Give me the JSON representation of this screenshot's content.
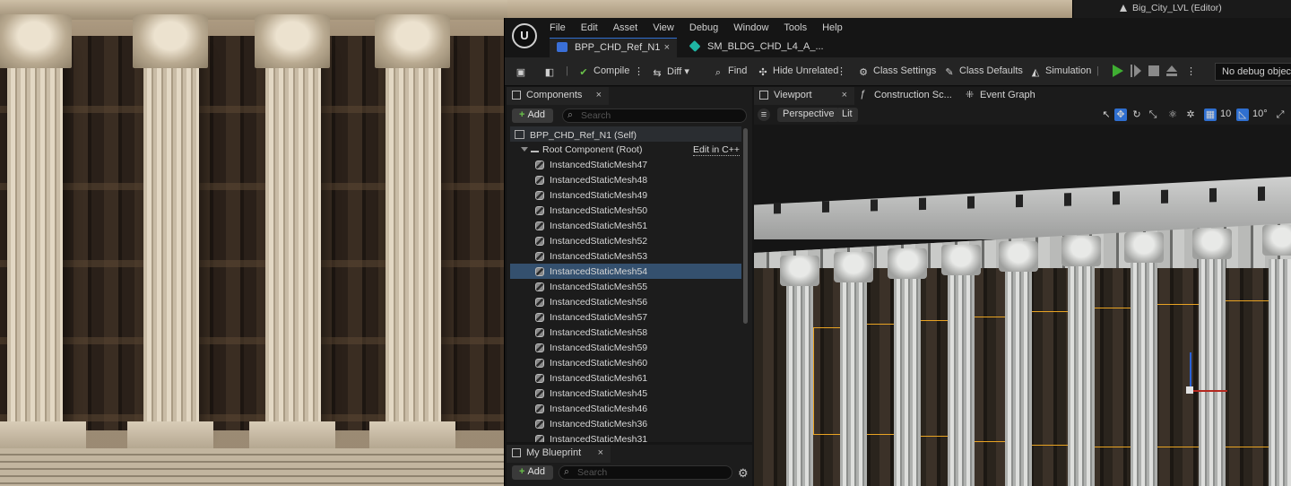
{
  "outliner": {
    "level_item": "Big_City_LVL (Editor)"
  },
  "menu": [
    "File",
    "Edit",
    "Asset",
    "View",
    "Debug",
    "Window",
    "Tools",
    "Help"
  ],
  "doc_tabs": [
    {
      "label": "BPP_CHD_Ref_N1",
      "active": true
    },
    {
      "label": "SM_BLDG_CHD_L4_A_...",
      "active": false
    }
  ],
  "toolbar": {
    "compile": "Compile",
    "diff": "Diff",
    "find": "Find",
    "hide_unrelated": "Hide Unrelated",
    "class_settings": "Class Settings",
    "class_defaults": "Class Defaults",
    "simulation": "Simulation",
    "debug_object": "No debug object se"
  },
  "components": {
    "tab": "Components",
    "add": "Add",
    "search_placeholder": "Search",
    "self_item": "BPP_CHD_Ref_N1 (Self)",
    "root_item": "Root Component (Root)",
    "edit_cpp": "Edit in C++",
    "items": [
      "InstancedStaticMesh47",
      "InstancedStaticMesh48",
      "InstancedStaticMesh49",
      "InstancedStaticMesh50",
      "InstancedStaticMesh51",
      "InstancedStaticMesh52",
      "InstancedStaticMesh53",
      "InstancedStaticMesh54",
      "InstancedStaticMesh55",
      "InstancedStaticMesh56",
      "InstancedStaticMesh57",
      "InstancedStaticMesh58",
      "InstancedStaticMesh59",
      "InstancedStaticMesh60",
      "InstancedStaticMesh61",
      "InstancedStaticMesh45",
      "InstancedStaticMesh46",
      "InstancedStaticMesh36",
      "InstancedStaticMesh31"
    ],
    "selected_item": "InstancedStaticMesh54"
  },
  "my_blueprint": {
    "tab": "My Blueprint",
    "add": "Add",
    "search_placeholder": "Search"
  },
  "viewport": {
    "tabs": [
      "Viewport",
      "Construction Sc...",
      "Event Graph"
    ],
    "perspective": "Perspective",
    "lit": "Lit",
    "grid_snap": "10",
    "rotation_snap": "10°"
  },
  "colors": {
    "accent_blue": "#2f6fd0",
    "selection_row": "#34506e",
    "selection_outline": "#e8a323",
    "play_green": "#3fae32",
    "add_plus_green": "#6ac24a"
  },
  "icons": {
    "save": "save-icon",
    "browse": "browse-icon",
    "compile": "compile-icon",
    "diff": "diff-icon",
    "find": "find-icon",
    "hide": "hide-unrelated-icon",
    "settings": "gear-icon",
    "defaults": "class-defaults-icon",
    "simulation": "simulation-icon",
    "play": "play-icon"
  }
}
